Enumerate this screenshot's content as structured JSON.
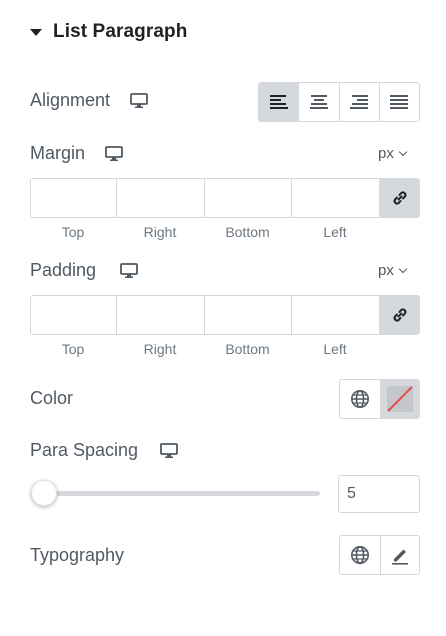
{
  "section": {
    "title": "List Paragraph",
    "expanded": true
  },
  "alignment": {
    "label": "Alignment",
    "device": "desktop-icon",
    "options": [
      "align-left-icon",
      "align-center-icon",
      "align-right-icon",
      "align-justify-icon"
    ],
    "selected": "align-left-icon"
  },
  "margin": {
    "label": "Margin",
    "device": "desktop-icon",
    "unit": "px",
    "values": {
      "top": "",
      "right": "",
      "bottom": "",
      "left": ""
    },
    "sides": [
      "Top",
      "Right",
      "Bottom",
      "Left"
    ],
    "linked": true,
    "link_icon": "link-icon"
  },
  "padding": {
    "label": "Padding",
    "device": "desktop-icon",
    "unit": "px",
    "values": {
      "top": "",
      "right": "",
      "bottom": "",
      "left": ""
    },
    "sides": [
      "Top",
      "Right",
      "Bottom",
      "Left"
    ],
    "linked": true,
    "link_icon": "link-icon"
  },
  "color": {
    "label": "Color",
    "global_icon": "globe-icon",
    "swatch": "no-color"
  },
  "para_spacing": {
    "label": "Para Spacing",
    "device": "desktop-icon",
    "value": "5",
    "slider_fraction": 0
  },
  "typography": {
    "label": "Typography",
    "global_icon": "globe-icon",
    "edit_icon": "pencil-icon"
  },
  "colors": {
    "text": "#515962",
    "title": "#1f2124",
    "border": "#d5d8dc",
    "active_bg": "#d5d8dc",
    "swatch_strike": "#e34a4a"
  }
}
